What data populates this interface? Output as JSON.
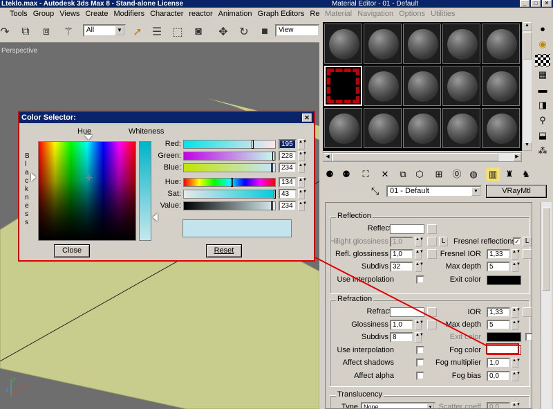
{
  "max": {
    "title": "Lteklo.max - Autodesk 3ds Max 8 - Stand-alone License",
    "menu": [
      "Tools",
      "Group",
      "Views",
      "Create",
      "Modifiers",
      "Character",
      "reactor",
      "Animation",
      "Graph Editors",
      "Rend"
    ],
    "selection_filter": "All",
    "ref_coord": "View",
    "viewport_label": "Perspective",
    "axes": {
      "y": "y",
      "z": "z",
      "x": "x"
    }
  },
  "color_selector": {
    "title": "Color Selector:",
    "hue_label": "Hue",
    "whiteness_label": "Whiteness",
    "blackness_letters": [
      "B",
      "l",
      "a",
      "c",
      "k",
      "n",
      "e",
      "s",
      "s"
    ],
    "channels": [
      {
        "label": "Red:",
        "value": "195",
        "grad": "linear-gradient(to right,#00e4ea,#ffe4ea)"
      },
      {
        "label": "Green:",
        "value": "228",
        "grad": "linear-gradient(to right,#c300ea,#c3ffea)"
      },
      {
        "label": "Blue:",
        "value": "234",
        "grad": "linear-gradient(to right,#c3e400,#c3e4ff)"
      },
      {
        "label": "Hue:",
        "value": "134",
        "grad": "linear-gradient(to right,#f00,#ff0,#0f0,#0ff,#00f,#f0f,#f00)"
      },
      {
        "label": "Sat:",
        "value": "43",
        "grad": "linear-gradient(to right,#e8e8e8,#00cce0)"
      },
      {
        "label": "Value:",
        "value": "234",
        "grad": "linear-gradient(to right,#000,#d8eef2)"
      }
    ],
    "close_label": "Close",
    "reset_label": "Reset",
    "current_color": "#c3e4ec"
  },
  "mat_editor": {
    "title": "Material Editor - 01 - Default",
    "menu": [
      "Material",
      "Navigation",
      "Options",
      "Utilities"
    ],
    "material_name": "01 - Default",
    "material_type": "VRayMtl"
  },
  "reflection": {
    "title": "Reflection",
    "reflect_label": "Reflect",
    "hilight_label": "Hilight glossiness",
    "hilight_value": "1,0",
    "l_label": "L",
    "fresnel_label": "Fresnel reflections",
    "fresnel_check": "✓",
    "fresnel_l": "L",
    "refl_gloss_label": "Refl. glossiness",
    "refl_gloss_value": "1,0",
    "fresnel_ior_label": "Fresnel IOR",
    "fresnel_ior_value": "1,33",
    "subdivs_label": "Subdivs",
    "subdivs_value": "32",
    "max_depth_label": "Max depth",
    "max_depth_value": "5",
    "use_interp_label": "Use interpolation",
    "exit_color_label": "Exit color"
  },
  "refraction": {
    "title": "Refraction",
    "refract_label": "Refract",
    "ior_label": "IOR",
    "ior_value": "1,33",
    "glossiness_label": "Glossiness",
    "glossiness_value": "1,0",
    "max_depth_label": "Max depth",
    "max_depth_value": "5",
    "subdivs_label": "Subdivs",
    "subdivs_value": "8",
    "exit_color_label": "Exit color",
    "use_interp_label": "Use interpolation",
    "fog_color_label": "Fog color",
    "affect_shadows_label": "Affect shadows",
    "fog_mult_label": "Fog multiplier",
    "fog_mult_value": "1,0",
    "affect_alpha_label": "Affect alpha",
    "fog_bias_label": "Fog bias",
    "fog_bias_value": "0,0"
  },
  "translucency": {
    "title": "Translucency",
    "type_label": "Type",
    "type_value": "None",
    "scatter_label": "Scatter coeff",
    "scatter_value": "0,0"
  }
}
